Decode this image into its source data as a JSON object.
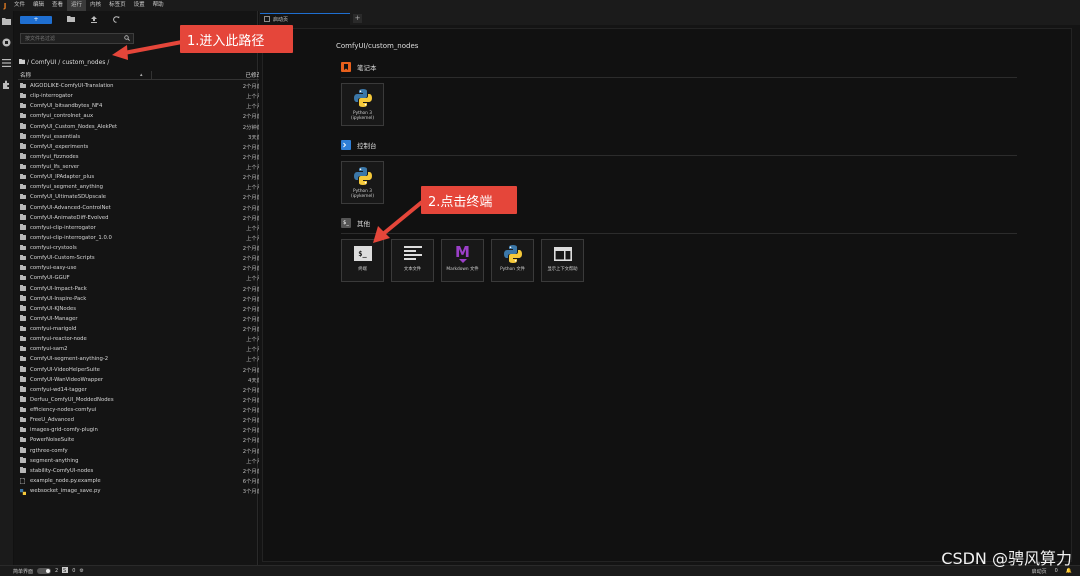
{
  "menubar": {
    "logo": "J",
    "items": [
      "文件",
      "编辑",
      "查看",
      "运行",
      "内核",
      "标签页",
      "设置",
      "帮助"
    ],
    "active_index": 3
  },
  "sidebar": {
    "new_label": "+",
    "filter_placeholder": "按文件名过滤",
    "breadcrumb": "/ ComfyUI / custom_nodes /",
    "col_name": "名称",
    "col_modified": "已修改",
    "items": [
      {
        "name": "AIGODLIKE-ComfyUI-Translation",
        "modified": "2个月前",
        "type": "folder"
      },
      {
        "name": "clip-interrogator",
        "modified": "上个月",
        "type": "folder"
      },
      {
        "name": "ComfyUI_bitsandbytes_NF4",
        "modified": "上个月",
        "type": "folder"
      },
      {
        "name": "comfyui_controlnet_aux",
        "modified": "2个月前",
        "type": "folder"
      },
      {
        "name": "ComfyUI_Custom_Nodes_AlekPet",
        "modified": "2分钟前",
        "type": "folder"
      },
      {
        "name": "comfyui_essentials",
        "modified": "3天前",
        "type": "folder"
      },
      {
        "name": "ComfyUI_experiments",
        "modified": "2个月前",
        "type": "folder"
      },
      {
        "name": "comfyui_fizznodes",
        "modified": "2个月前",
        "type": "folder"
      },
      {
        "name": "comfyui_lfs_server",
        "modified": "上个月",
        "type": "folder"
      },
      {
        "name": "ComfyUI_IPAdapter_plus",
        "modified": "2个月前",
        "type": "folder"
      },
      {
        "name": "comfyui_segment_anything",
        "modified": "上个月",
        "type": "folder"
      },
      {
        "name": "ComfyUI_UltimateSDUpscale",
        "modified": "2个月前",
        "type": "folder"
      },
      {
        "name": "ComfyUI-Advanced-ControlNet",
        "modified": "2个月前",
        "type": "folder"
      },
      {
        "name": "ComfyUI-AnimateDiff-Evolved",
        "modified": "2个月前",
        "type": "folder"
      },
      {
        "name": "comfyui-clip-interrogator",
        "modified": "上个月",
        "type": "folder"
      },
      {
        "name": "comfyui-clip-interrogator_1.0.0",
        "modified": "上个月",
        "type": "folder"
      },
      {
        "name": "comfyui-crystools",
        "modified": "2个月前",
        "type": "folder"
      },
      {
        "name": "ComfyUI-Custom-Scripts",
        "modified": "2个月前",
        "type": "folder"
      },
      {
        "name": "comfyui-easy-use",
        "modified": "2个月前",
        "type": "folder"
      },
      {
        "name": "ComfyUI-GGUF",
        "modified": "上个月",
        "type": "folder"
      },
      {
        "name": "ComfyUI-Impact-Pack",
        "modified": "2个月前",
        "type": "folder"
      },
      {
        "name": "ComfyUI-Inspire-Pack",
        "modified": "2个月前",
        "type": "folder"
      },
      {
        "name": "ComfyUI-KJNodes",
        "modified": "2个月前",
        "type": "folder"
      },
      {
        "name": "ComfyUI-Manager",
        "modified": "2个月前",
        "type": "folder"
      },
      {
        "name": "comfyui-marigold",
        "modified": "2个月前",
        "type": "folder"
      },
      {
        "name": "comfyui-reactor-node",
        "modified": "上个月",
        "type": "folder"
      },
      {
        "name": "comfyui-sam2",
        "modified": "上个月",
        "type": "folder"
      },
      {
        "name": "ComfyUI-segment-anything-2",
        "modified": "上个月",
        "type": "folder"
      },
      {
        "name": "ComfyUI-VideoHelperSuite",
        "modified": "2个月前",
        "type": "folder"
      },
      {
        "name": "ComfyUI-WanVideoWrapper",
        "modified": "4天前",
        "type": "folder"
      },
      {
        "name": "comfyui-wd14-tagger",
        "modified": "2个月前",
        "type": "folder"
      },
      {
        "name": "Derfuu_ComfyUI_ModdedNodes",
        "modified": "2个月前",
        "type": "folder"
      },
      {
        "name": "efficiency-nodes-comfyui",
        "modified": "2个月前",
        "type": "folder"
      },
      {
        "name": "FreeU_Advanced",
        "modified": "2个月前",
        "type": "folder"
      },
      {
        "name": "images-grid-comfy-plugin",
        "modified": "2个月前",
        "type": "folder"
      },
      {
        "name": "PowerNoiseSuite",
        "modified": "2个月前",
        "type": "folder"
      },
      {
        "name": "rgthree-comfy",
        "modified": "2个月前",
        "type": "folder"
      },
      {
        "name": "segment-anything",
        "modified": "上个月",
        "type": "folder"
      },
      {
        "name": "stability-ComfyUI-nodes",
        "modified": "2个月前",
        "type": "folder"
      },
      {
        "name": "example_node.py.example",
        "modified": "6个月前",
        "type": "file"
      },
      {
        "name": "websocket_image_save.py",
        "modified": "3个月前",
        "type": "python"
      }
    ]
  },
  "main": {
    "tab_label": "启动页",
    "launcher_path": "ComfyUI/custom_nodes",
    "sections": [
      {
        "title": "笔记本",
        "icon_color": "#e8601c",
        "icon": "bookmark-icon"
      },
      {
        "title": "控制台",
        "icon_color": "#2f7fd6",
        "icon": "console-icon"
      },
      {
        "title": "其他",
        "icon_color": "#555555",
        "icon": "terminal-icon"
      }
    ],
    "notebook_card": "Python 3 (ipykernel)",
    "console_card": "Python 3 (ipykernel)",
    "other_cards": [
      "终端",
      "文本文件",
      "Markdown 文件",
      "Python 文件",
      "显示上下文帮助"
    ]
  },
  "annotations": {
    "first": "1.进入此路径",
    "second": "2.点击终端",
    "color": "#e5463a"
  },
  "statusbar": {
    "simple_label": "简单界面",
    "num_a": "2",
    "num_b": "0",
    "right_label": "启动页",
    "right_num": "0"
  },
  "watermark": "CSDN @骋风算力"
}
